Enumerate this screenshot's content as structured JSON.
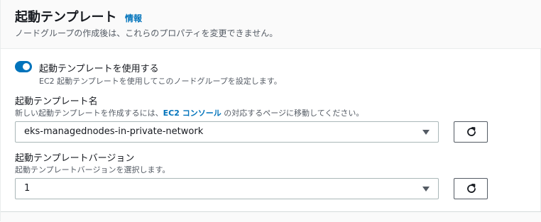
{
  "header": {
    "title": "起動テンプレート",
    "info_link": "情報",
    "description": "ノードグループの作成後は、これらのプロパティを変更できません。"
  },
  "use_template": {
    "enabled": true,
    "label": "起動テンプレートを使用する",
    "description": "EC2 起動テンプレートを使用してこのノードグループを設定します。"
  },
  "template_name": {
    "label": "起動テンプレート名",
    "desc_before": "新しい起動テンプレートを作成するには、",
    "desc_link": "EC2 コンソール",
    "desc_after": " の対応するページに移動してください。",
    "selected": "eks-managednodes-in-private-network",
    "refresh_icon": "refresh-icon"
  },
  "template_version": {
    "label": "起動テンプレートバージョン",
    "description": "起動テンプレートバージョンを選択します。",
    "selected": "1",
    "refresh_icon": "refresh-icon"
  },
  "colors": {
    "accent": "#0073bb",
    "text": "#16191f",
    "secondary_text": "#545b64",
    "border": "#aab7b8"
  }
}
